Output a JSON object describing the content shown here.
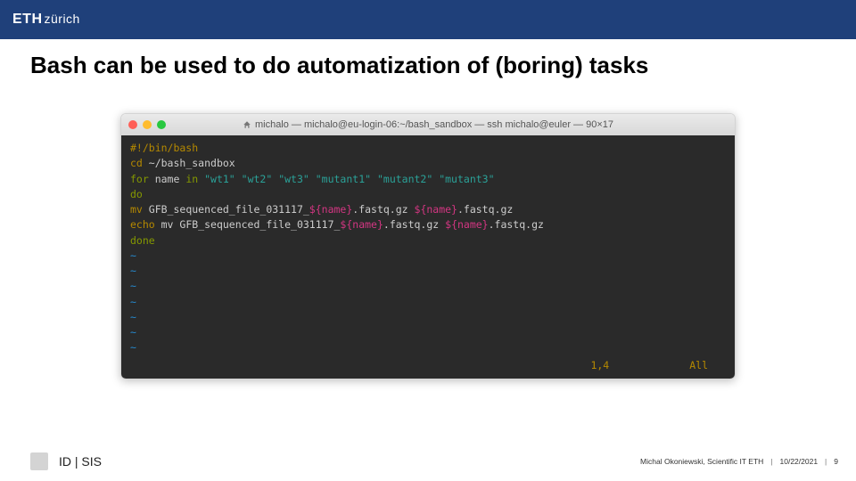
{
  "header": {
    "logo_main": "ETH",
    "logo_sub": "zürich"
  },
  "title": "Bash can be used to do automatization of (boring) tasks",
  "terminal": {
    "window_title": "michalo — michalo@eu-login-06:~/bash_sandbox — ssh michalo@euler — 90×17",
    "lines": {
      "shebang": "#!/bin/bash",
      "blank1": " ",
      "cd_cmd": "cd",
      "cd_path": " ~/bash_sandbox",
      "blank2": " ",
      "for_kw": "for",
      "for_var": " name ",
      "for_in": "in ",
      "for_args": "\"wt1\" \"wt2\" \"wt3\" \"mutant1\" \"mutant2\" \"mutant3\"",
      "do_kw": "do",
      "mv_indent": "   ",
      "mv_cmd": "mv",
      "mv_a": " GFB_sequenced_file_031117_",
      "mv_var1": "${name}",
      "mv_b": ".fastq.gz ",
      "mv_var2": "${name}",
      "mv_c": ".fastq.gz",
      "echo_indent": "   ",
      "echo_cmd": "echo",
      "echo_a": " mv GFB_sequenced_file_031117_",
      "echo_var1": "${name}",
      "echo_b": ".fastq.gz ",
      "echo_var2": "${name}",
      "echo_c": ".fastq.gz",
      "done_kw": "done",
      "tilde": "~",
      "status_pos": "1,4",
      "status_all": "All"
    }
  },
  "footer": {
    "idsis": "ID | SIS",
    "author": "Michal Okoniewski, Scientific IT ETH",
    "date": "10/22/2021",
    "page": "9"
  }
}
